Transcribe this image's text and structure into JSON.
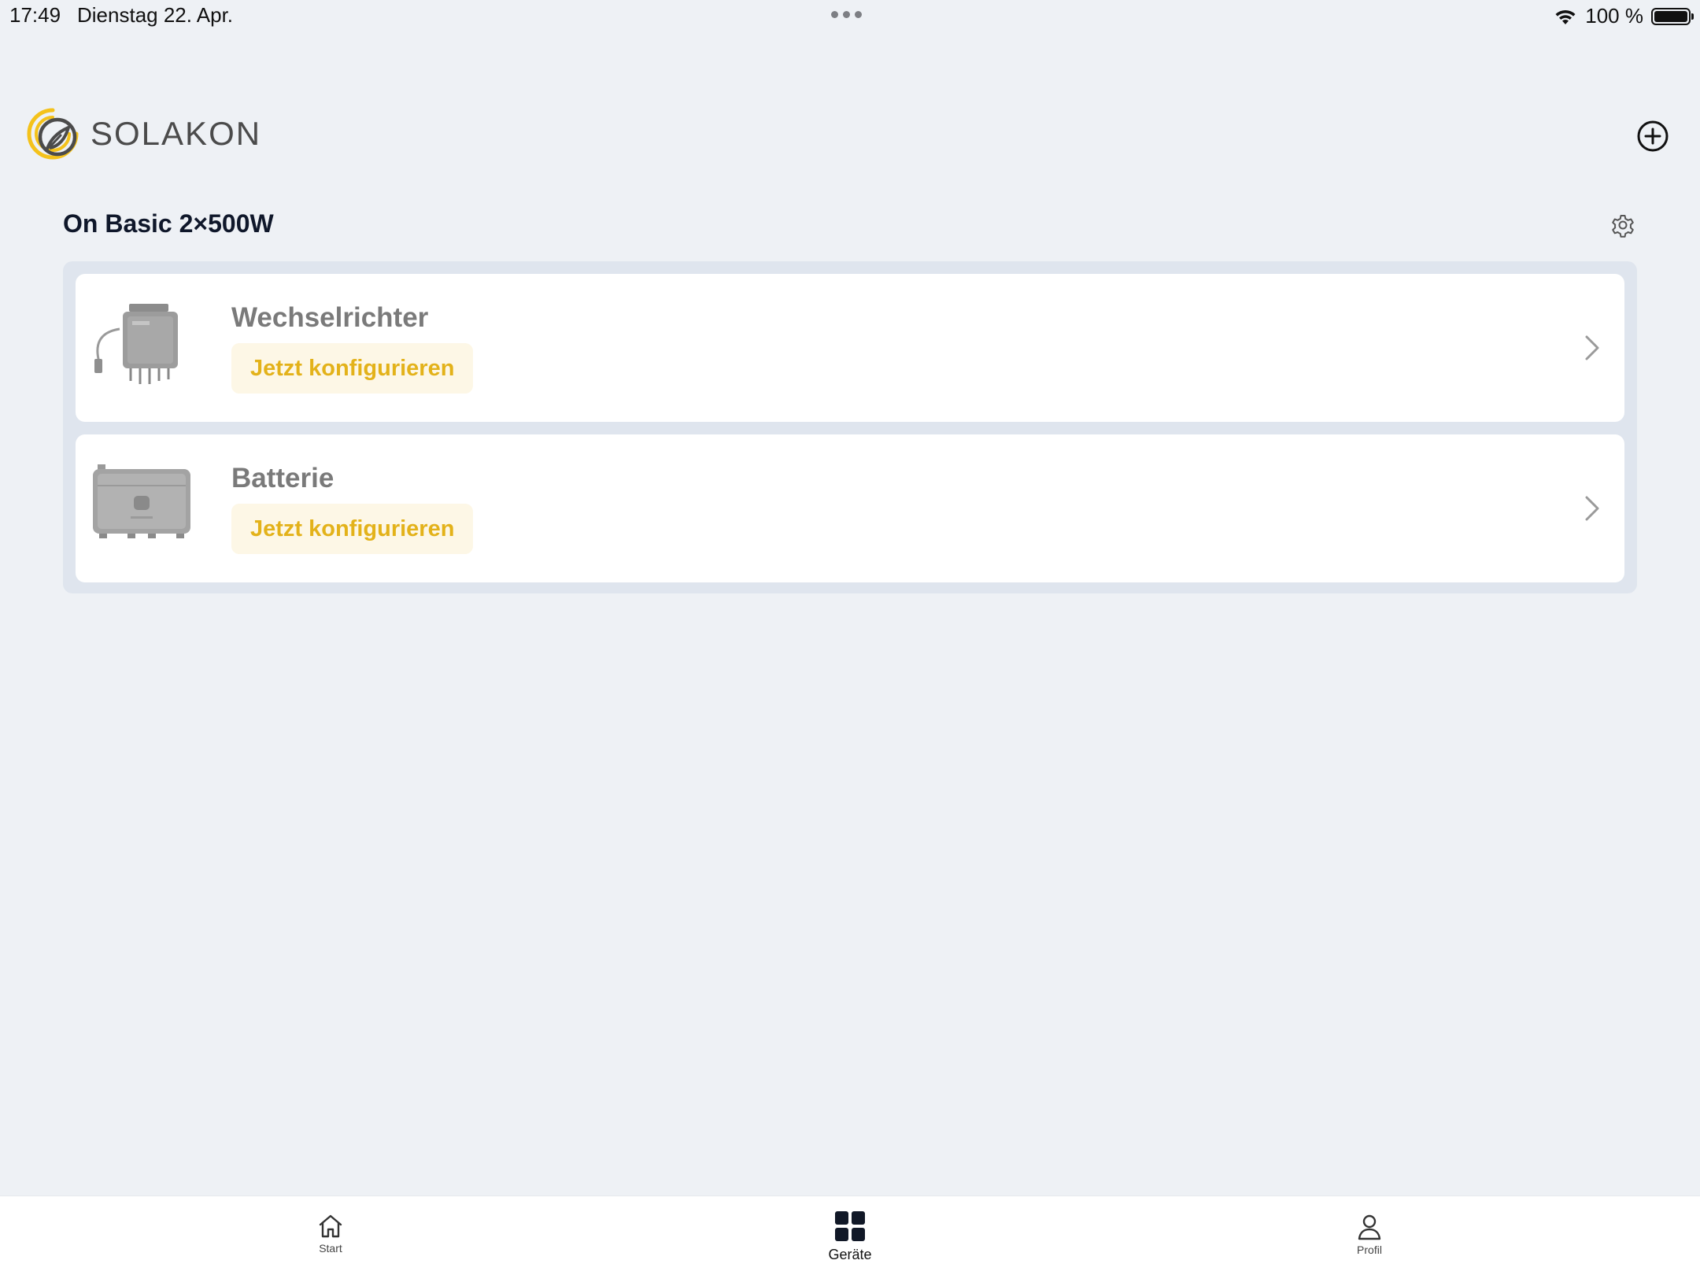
{
  "status_bar": {
    "time": "17:49",
    "date": "Dienstag 22. Apr.",
    "battery": "100 %"
  },
  "header": {
    "brand": "SOLAKON",
    "logo_icon": "solakon-logo-icon",
    "add_icon": "plus-circle-icon"
  },
  "group": {
    "title": "On Basic 2×500W",
    "settings_icon": "gear-icon"
  },
  "devices": [
    {
      "name": "Wechselrichter",
      "action": "Jetzt konfigurieren",
      "image": "inverter-image"
    },
    {
      "name": "Batterie",
      "action": "Jetzt konfigurieren",
      "image": "battery-image"
    }
  ],
  "tabs": [
    {
      "label": "Start",
      "icon": "home-icon"
    },
    {
      "label": "Geräte",
      "icon": "grid-icon",
      "active": true
    },
    {
      "label": "Profil",
      "icon": "person-icon"
    }
  ],
  "colors": {
    "background": "#eef1f5",
    "accent": "#e3b21a",
    "badge_background": "#fdf7e6",
    "container": "#dfe5ee"
  }
}
